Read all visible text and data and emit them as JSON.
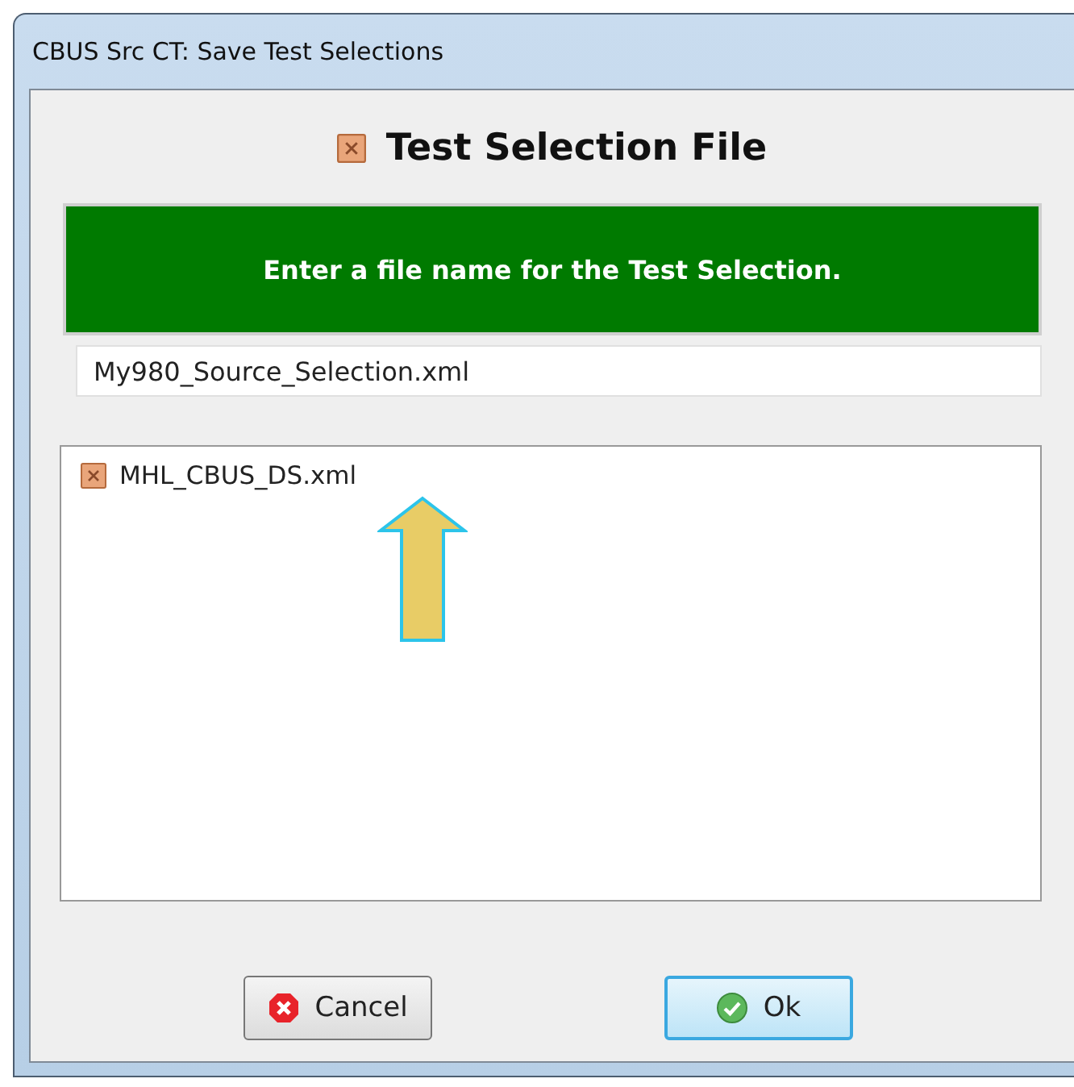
{
  "window": {
    "title": "CBUS Src CT: Save Test Selections"
  },
  "heading": "Test Selection File",
  "banner": "Enter a file name for the Test Selection.",
  "filename_field": {
    "value": "My980_Source_Selection.xml"
  },
  "files": [
    {
      "name": "MHL_CBUS_DS.xml",
      "selected": false
    }
  ],
  "buttons": [
    {
      "label": "Cancel",
      "kind": "cancel",
      "focused": false
    },
    {
      "label": "Ok",
      "kind": "ok",
      "focused": true
    }
  ]
}
